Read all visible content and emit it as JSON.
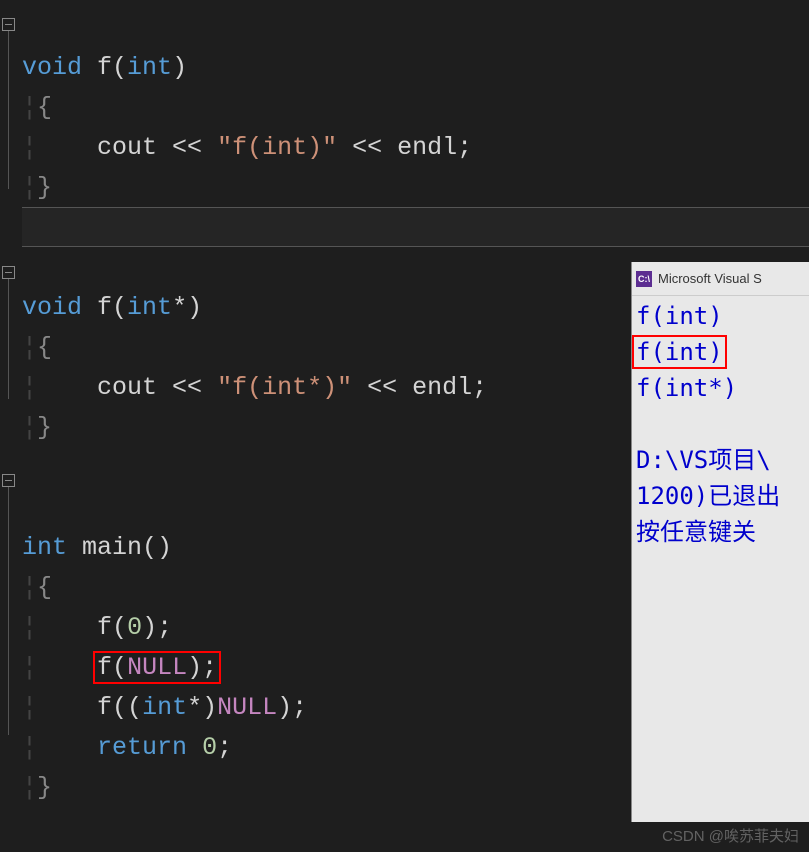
{
  "code": {
    "l01_void": "void",
    "l01_f": " f",
    "l01_paren_open": "(",
    "l01_int": "int",
    "l01_paren_close": ")",
    "l02_brace": "{",
    "l03_indent": "    ",
    "l03_cout": "cout ",
    "l03_op1": "<< ",
    "l03_str": "\"f(int)\"",
    "l03_op2": " << ",
    "l03_endl": "endl",
    "l03_semi": ";",
    "l04_brace": "}",
    "l06_void": "void",
    "l06_f": " f",
    "l06_paren_open": "(",
    "l06_int": "int",
    "l06_star": "*",
    "l06_paren_close": ")",
    "l07_brace": "{",
    "l08_indent": "    ",
    "l08_cout": "cout ",
    "l08_op1": "<< ",
    "l08_str": "\"f(int*)\"",
    "l08_op2": " << ",
    "l08_endl": "endl",
    "l08_semi": ";",
    "l09_brace": "}",
    "l11_int": "int",
    "l11_main": " main",
    "l11_parens": "()",
    "l12_brace": "{",
    "l13_indent": "    ",
    "l13_f": "f",
    "l13_po": "(",
    "l13_zero": "0",
    "l13_pc": ")",
    "l13_semi": ";",
    "l14_indent": "    ",
    "l14_f": "f",
    "l14_po": "(",
    "l14_null": "NULL",
    "l14_pc": ")",
    "l14_semi": ";",
    "l15_indent": "    ",
    "l15_f": "f",
    "l15_po": "((",
    "l15_int": "int",
    "l15_star": "*",
    "l15_pc1": ")",
    "l15_null": "NULL",
    "l15_pc2": ")",
    "l15_semi": ";",
    "l16_indent": "    ",
    "l16_return": "return",
    "l16_sp": " ",
    "l16_zero": "0",
    "l16_semi": ";",
    "l17_brace": "}"
  },
  "console": {
    "title": "Microsoft Visual S",
    "icon_text": "C:\\",
    "line1": "f(int)",
    "line2": "f(int)",
    "line3": "f(int*)",
    "blank": "",
    "line4": "D:\\VS项目\\",
    "line5": "1200)已退出",
    "line6": "按任意键关"
  },
  "watermark": "CSDN @唉苏菲夫妇"
}
